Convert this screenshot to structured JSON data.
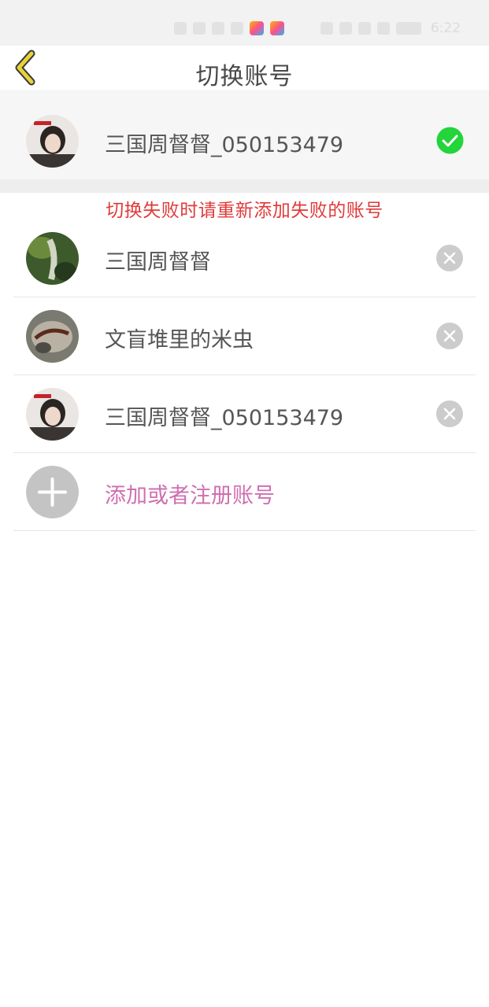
{
  "status_bar": {
    "time": "6:22",
    "icons": [
      "sim-icon",
      "signal-icon",
      "wifi-icon",
      "battery-saver-icon",
      "app-icon-1",
      "app-icon-2",
      "alarm-icon",
      "nfc-icon",
      "bluetooth-icon",
      "phone-icon",
      "battery-icon"
    ]
  },
  "nav": {
    "title": "切换账号",
    "back_icon": "chevron-left-icon",
    "back_color": "#e8d23a"
  },
  "current_account": {
    "name": "三国周督督_050153479",
    "status_icon": "check-circle-icon",
    "status_color": "#23d43a"
  },
  "notice": {
    "text": "切换失败时请重新添加失败的账号",
    "color": "#e03a3a"
  },
  "accounts": [
    {
      "name": "三国周督督",
      "action_icon": "remove-circle-icon"
    },
    {
      "name": "文盲堆里的米虫",
      "action_icon": "remove-circle-icon"
    },
    {
      "name": "三国周督督_050153479",
      "action_icon": "remove-circle-icon"
    }
  ],
  "add_account": {
    "label": "添加或者注册账号",
    "icon": "plus-circle-icon",
    "color": "#cf6fb0"
  }
}
